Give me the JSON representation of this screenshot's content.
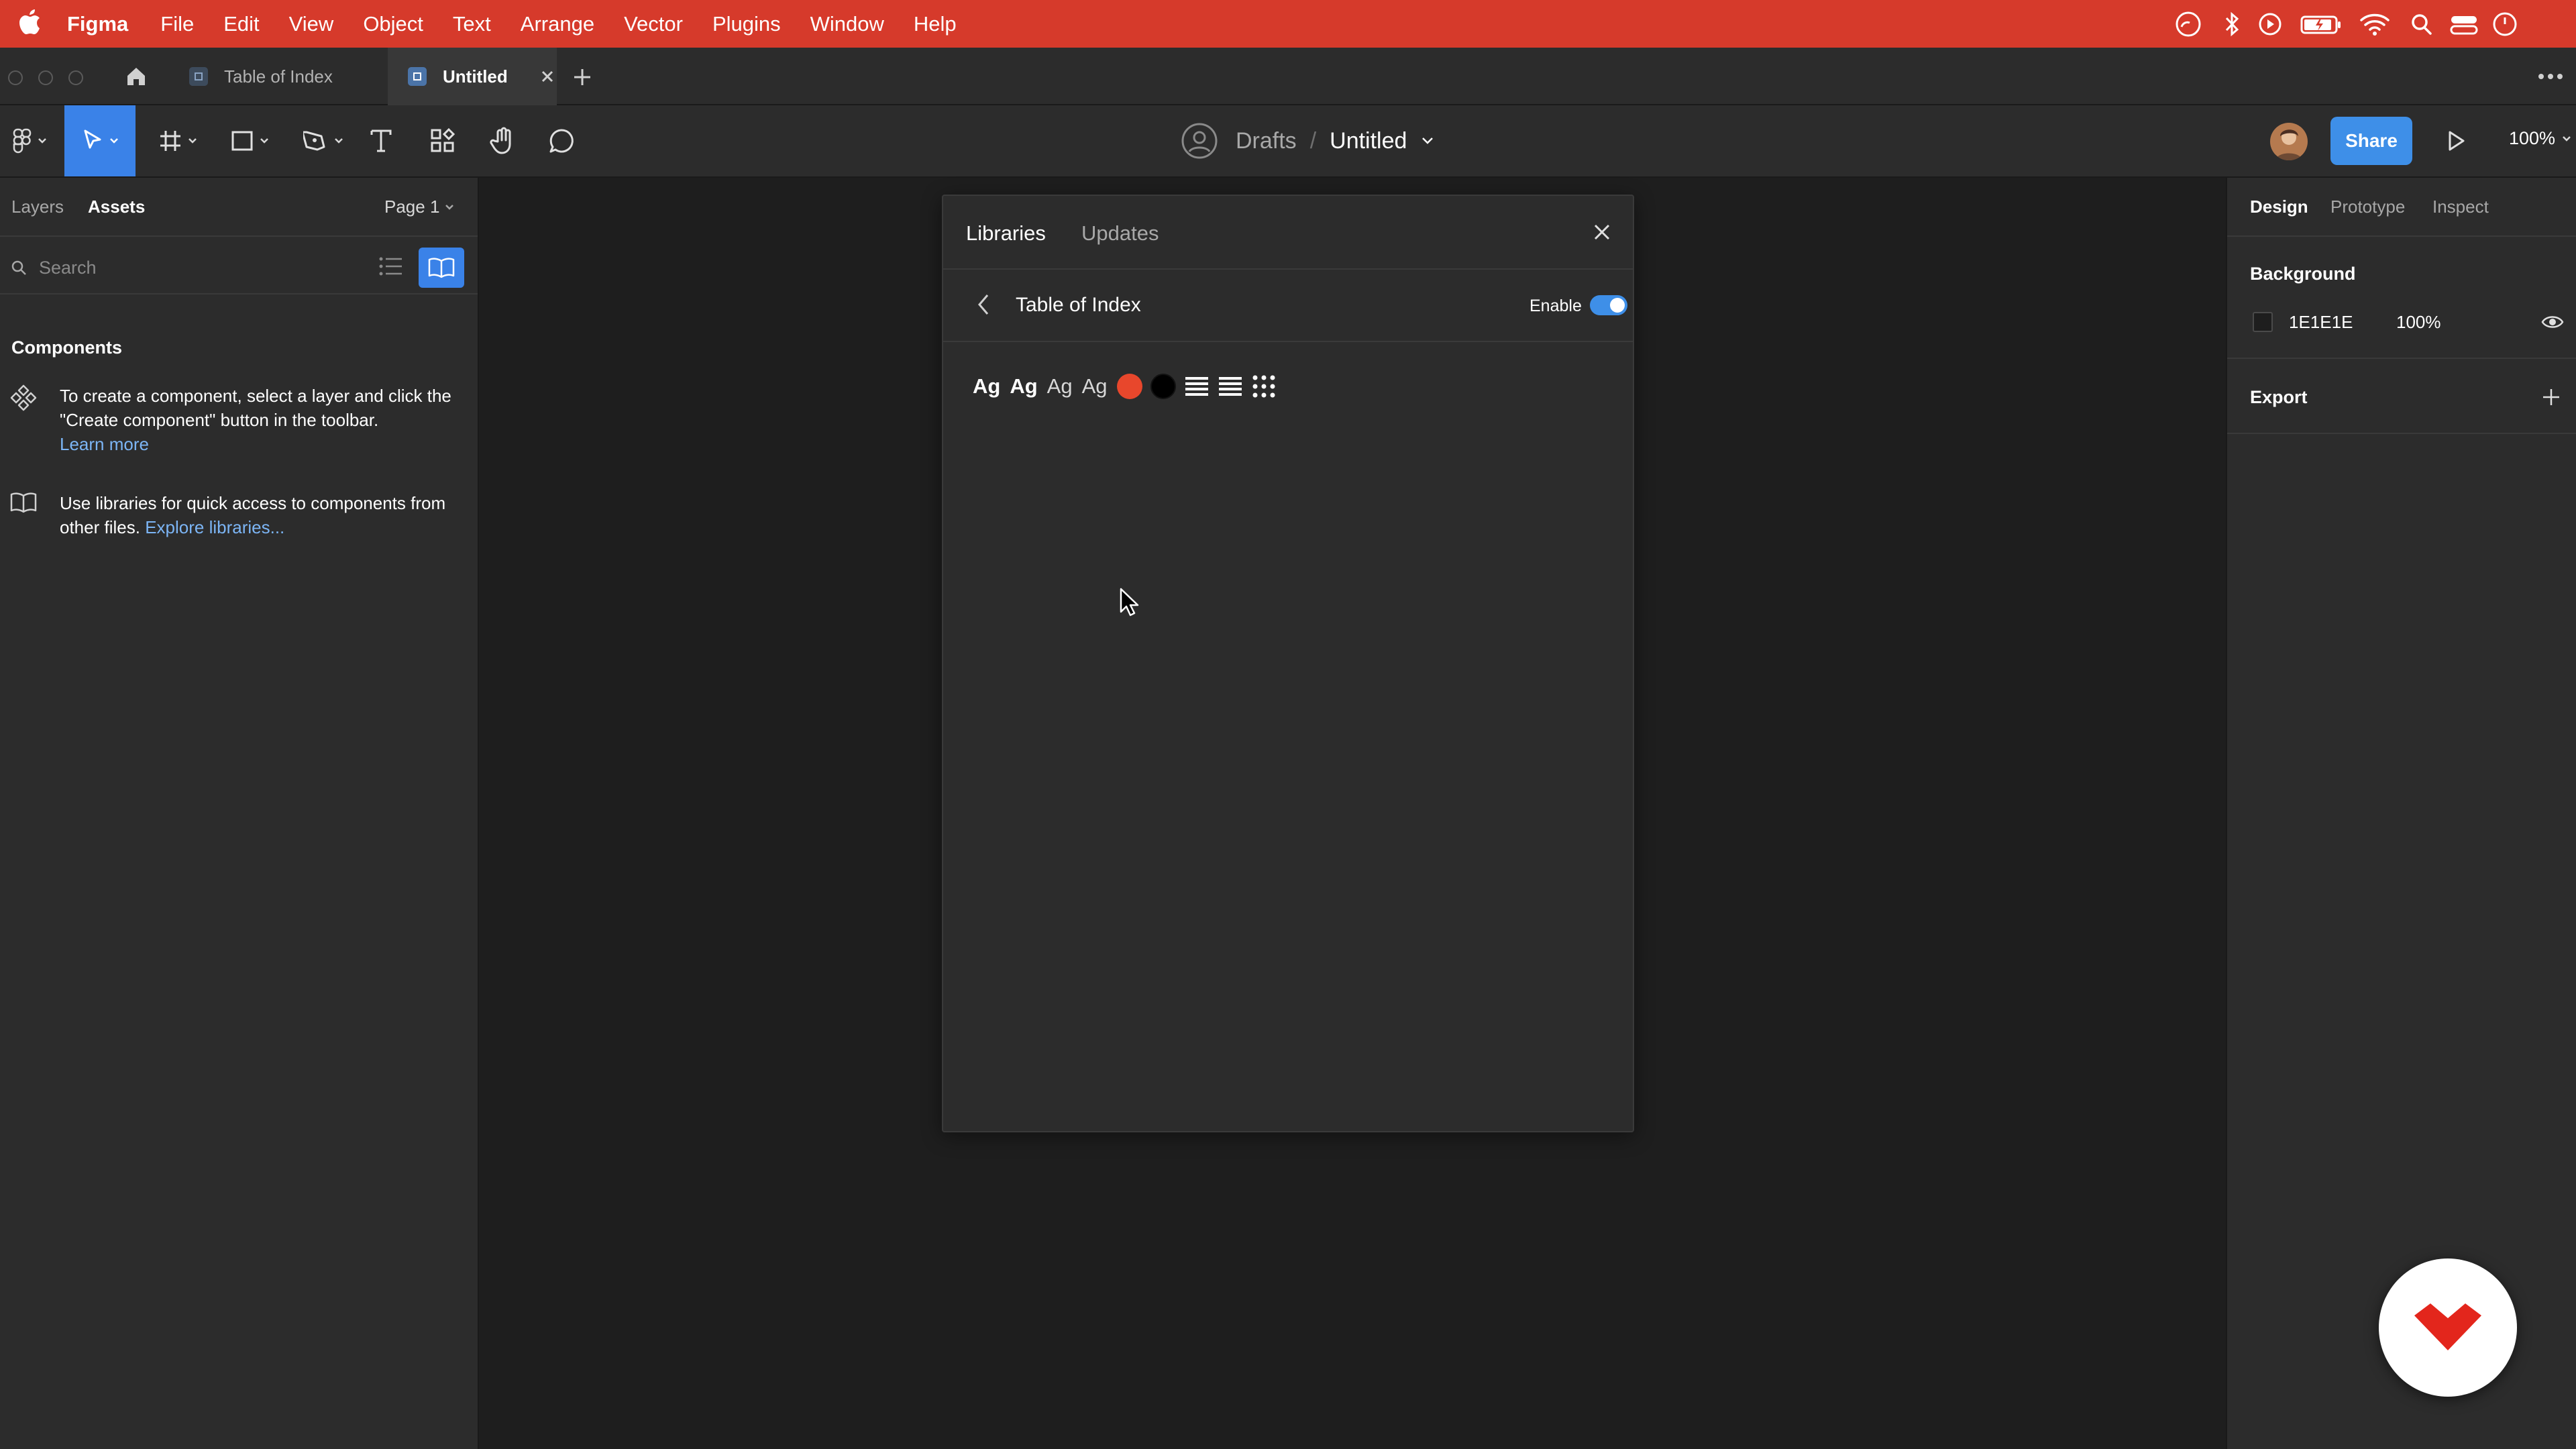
{
  "menubar": {
    "app_name": "Figma",
    "items": [
      "File",
      "Edit",
      "View",
      "Object",
      "Text",
      "Arrange",
      "Vector",
      "Plugins",
      "Window",
      "Help"
    ],
    "status_icons": [
      "creative-cloud-icon",
      "bluetooth-icon",
      "play-circle-icon",
      "battery-icon",
      "wifi-icon",
      "spotlight-search-icon",
      "control-center-icon",
      "clock-icon"
    ]
  },
  "tabs": {
    "items": [
      {
        "label": "Table of Index",
        "active": false
      },
      {
        "label": "Untitled",
        "active": true
      }
    ]
  },
  "toolbar": {
    "breadcrumb_folder": "Drafts",
    "breadcrumb_separator": "/",
    "file_title": "Untitled",
    "share_label": "Share",
    "zoom_label": "100%"
  },
  "left_panel": {
    "tab_layers": "Layers",
    "tab_assets": "Assets",
    "page_selector": "Page 1",
    "search_placeholder": "Search",
    "components_heading": "Components",
    "component_hint_text": "To create a component, select a layer and click the \"Create component\" button in the toolbar.",
    "component_hint_link": "Learn more",
    "library_hint_text": "Use libraries for quick access to components from other files.",
    "library_hint_link": "Explore libraries..."
  },
  "libraries_modal": {
    "tab_libraries": "Libraries",
    "tab_updates": "Updates",
    "library_name": "Table of Index",
    "enable_label": "Enable",
    "enabled": true,
    "text_styles": [
      "Ag",
      "Ag",
      "Ag",
      "Ag"
    ],
    "color_styles": [
      "#e8472c",
      "#000000"
    ],
    "effect_styles": [
      "list-lines-icon",
      "list-lines-icon",
      "grid-dots-icon"
    ]
  },
  "right_panel": {
    "tab_design": "Design",
    "tab_prototype": "Prototype",
    "tab_inspect": "Inspect",
    "background_heading": "Background",
    "background_hex": "1E1E1E",
    "background_opacity": "100%",
    "export_heading": "Export"
  },
  "colors": {
    "menubar": "#d63a2b",
    "accent": "#3e8fe8",
    "canvas": "#1e1e1e",
    "panel": "#2c2c2c"
  }
}
